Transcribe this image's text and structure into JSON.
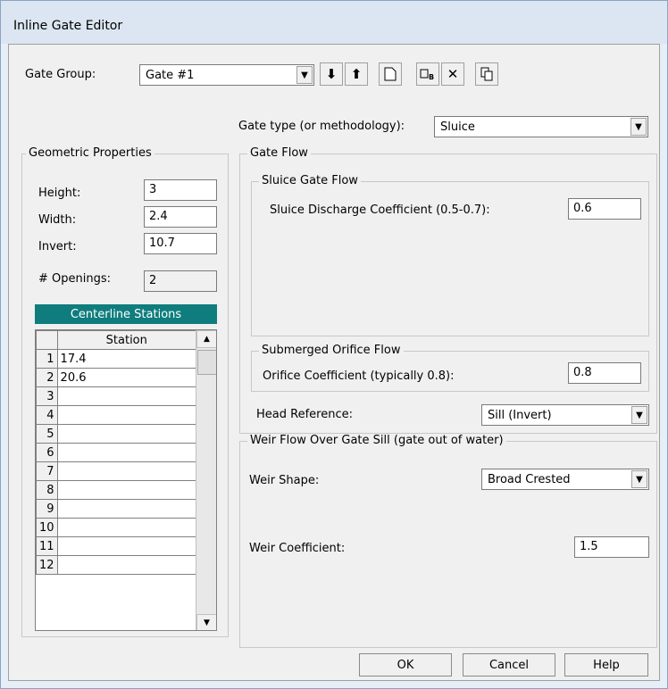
{
  "window": {
    "title": "Inline Gate Editor"
  },
  "gate_group": {
    "label": "Gate Group:",
    "value": "Gate #1"
  },
  "toolbar": {
    "down": "⬇",
    "up": "⬆",
    "new": "",
    "rename": "",
    "delete": "✕",
    "copy": ""
  },
  "gate_type": {
    "label": "Gate type (or methodology):",
    "value": "Sluice"
  },
  "geometric": {
    "title": "Geometric Properties",
    "height_label": "Height:",
    "height_value": "3",
    "width_label": "Width:",
    "width_value": "2.4",
    "invert_label": "Invert:",
    "invert_value": "10.7",
    "openings_label": "# Openings:",
    "openings_value": "2"
  },
  "centerline": {
    "header": "Centerline Stations",
    "column": "Station",
    "rows": [
      {
        "n": "1",
        "v": "17.4"
      },
      {
        "n": "2",
        "v": "20.6"
      },
      {
        "n": "3",
        "v": ""
      },
      {
        "n": "4",
        "v": ""
      },
      {
        "n": "5",
        "v": ""
      },
      {
        "n": "6",
        "v": ""
      },
      {
        "n": "7",
        "v": ""
      },
      {
        "n": "8",
        "v": ""
      },
      {
        "n": "9",
        "v": ""
      },
      {
        "n": "10",
        "v": ""
      },
      {
        "n": "11",
        "v": ""
      },
      {
        "n": "12",
        "v": ""
      }
    ]
  },
  "gate_flow": {
    "title": "Gate Flow",
    "sluice_title": "Sluice Gate Flow",
    "sluice_coef_label": "Sluice Discharge Coefficient (0.5-0.7):",
    "sluice_coef_value": "0.6",
    "orifice_title": "Submerged Orifice Flow",
    "orifice_coef_label": "Orifice Coefficient (typically 0.8):",
    "orifice_coef_value": "0.8",
    "head_ref_label": "Head Reference:",
    "head_ref_value": "Sill (Invert)"
  },
  "weir": {
    "title": "Weir Flow Over Gate Sill (gate out of water)",
    "shape_label": "Weir Shape:",
    "shape_value": "Broad Crested",
    "coef_label": "Weir Coefficient:",
    "coef_value": "1.5"
  },
  "buttons": {
    "ok": "OK",
    "cancel": "Cancel",
    "help": "Help"
  }
}
